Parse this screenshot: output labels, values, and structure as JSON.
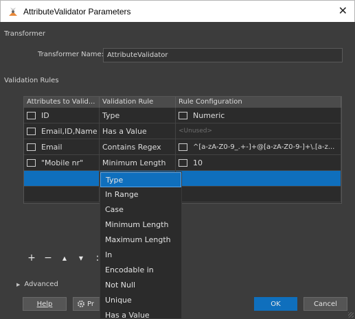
{
  "window": {
    "title": "AttributeValidator Parameters",
    "close_glyph": "✕",
    "logo_icon": "fme-transformer-icon"
  },
  "sections": {
    "transformer": "Transformer",
    "validation_rules": "Validation Rules",
    "advanced": "Advanced"
  },
  "transformer": {
    "name_label": "Transformer Name:",
    "name_value": "AttributeValidator"
  },
  "table": {
    "headers": [
      "Attributes to Valid...",
      "Validation Rule",
      "Rule Configuration"
    ],
    "rows": [
      {
        "attrs": "ID",
        "rule": "Type",
        "config": "Numeric",
        "config_checkbox": true
      },
      {
        "attrs": "Email,ID,Name",
        "rule": "Has a Value",
        "config": "<Unused>",
        "config_checkbox": false
      },
      {
        "attrs": "Email",
        "rule": "Contains Regex",
        "config": "^[a-zA-Z0-9_.+-]+@[a-zA-Z0-9-]+\\.[a-z...",
        "config_checkbox": true
      },
      {
        "attrs": "\"Mobile nr\"",
        "rule": "Minimum Length",
        "config": "10",
        "config_checkbox": true
      }
    ]
  },
  "toolbar": {
    "add": "+",
    "remove": "−",
    "up": "▲",
    "down": "▼",
    "more": ":"
  },
  "dropdown": {
    "selected": "Type",
    "options": [
      "Type",
      "In Range",
      "Case",
      "Minimum Length",
      "Maximum Length",
      "In",
      "Encodable in",
      "Not Null",
      "Unique",
      "Has a Value"
    ]
  },
  "buttons": {
    "help": "Help",
    "defaults": "Pr",
    "ok": "OK",
    "cancel": "Cancel"
  },
  "colors": {
    "accent": "#0f6fbd",
    "background": "#3c3c3c",
    "table_bg": "#2b2b2b"
  }
}
